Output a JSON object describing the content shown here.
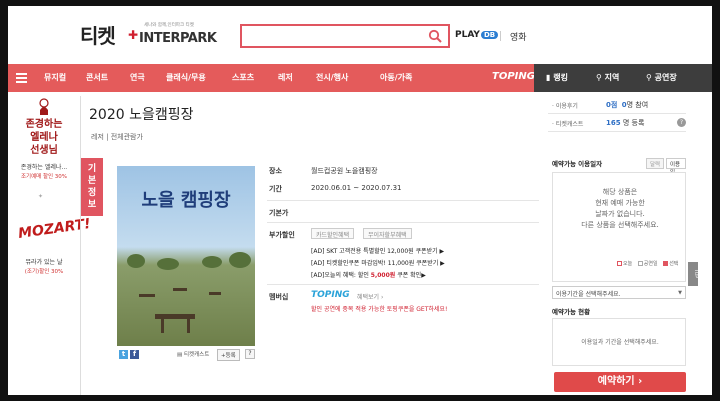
{
  "header": {
    "logo_ko": "티켓",
    "logo_sub": "세나와 함께,인터파크 티켓",
    "logo_brand": "INTERPARK",
    "play_logo": "PLAY",
    "play_badge": "DB",
    "movie": "영화"
  },
  "nav": {
    "items": [
      "뮤지컬",
      "콘서트",
      "연극",
      "클래식/무용",
      "스포츠",
      "레저",
      "전시/행사",
      "아동/가족"
    ],
    "toping": "TOPING",
    "ranking": "랭킹",
    "region": "지역",
    "venue": "공연장"
  },
  "ads": {
    "ad1_title_1": "존경하는",
    "ad1_title_2": "엘레나",
    "ad1_title_3": "선생님",
    "ad1_line": "존경하는 엘레나...",
    "ad1_discount": "조기예매 할인 30%",
    "ad2_logo": "MOZART!",
    "ad2_line": "뮤라가 있는 날",
    "ad2_discount": "(조기)할인 30%"
  },
  "product": {
    "title": "2020 노을캠핑장",
    "breadcrumb": "레저 | 전체관람가",
    "info_tab": "기본정보",
    "poster_title": "노을 캠핑장",
    "cast_button": "티켓캐스트",
    "register_button": "+등록",
    "help_button": "?",
    "place_label": "장소",
    "place_value": "월드컵공원 노을캠핑장",
    "period_label": "기간",
    "period_value": "2020.06.01 ~ 2020.07.31",
    "price_label": "기본가",
    "benefit_label": "부가할인",
    "benefit_pill_1": "카드할인혜택",
    "benefit_pill_2": "무이자할부혜택",
    "promo_1_prefix": "[AD] SKT 고객전용 특별할인 ",
    "promo_1_amount": "12,000원",
    "promo_1_suffix": " 쿠폰받기 ▶",
    "promo_2_prefix": "[AD] 티켓할인쿠폰 마감임박! ",
    "promo_2_amount": "11,000원",
    "promo_2_suffix": " 쿠폰받기 ▶",
    "promo_3_prefix": "[AD]오늘의 혜택: 할인 ",
    "promo_3_amount": "5,000원",
    "promo_3_suffix": " 쿠폰 확인▶",
    "membership_label": "멤버십",
    "toping_logo": "TOPING",
    "toping_sub": "혜택보기 ›",
    "toping_desc": "할인 공연에 중복 적용 가능한 토핑쿠폰을 GET하세요!"
  },
  "sidebar": {
    "reviews_label": "· 이용후기",
    "reviews_count": "0점",
    "reviews_count2": "0",
    "reviews_suffix": "명 참여",
    "cast_label": "· 티켓캐스트",
    "cast_count": "165",
    "cast_suffix": "명 등록",
    "help_icon": "?",
    "date_title": "예약가능 이용일자",
    "toggle_calendar": "달력",
    "toggle_other": "이용일",
    "cal_msg_1": "해당 상품은",
    "cal_msg_2": "현재 예매 가능한",
    "cal_msg_3": "날짜가 없습니다.",
    "cal_msg_4": "다른 상품을 선택해주세요.",
    "legend_today": "오늘",
    "legend_holiday": "공연일",
    "legend_selected": "선택",
    "period_select": "이용기간을 선택해주세요.",
    "status_title": "예약가능 현황",
    "status_msg": "이용일과 기간을 선택해주세요.",
    "book_button": "예약하기 ›",
    "scroll_tab": "TOP"
  }
}
